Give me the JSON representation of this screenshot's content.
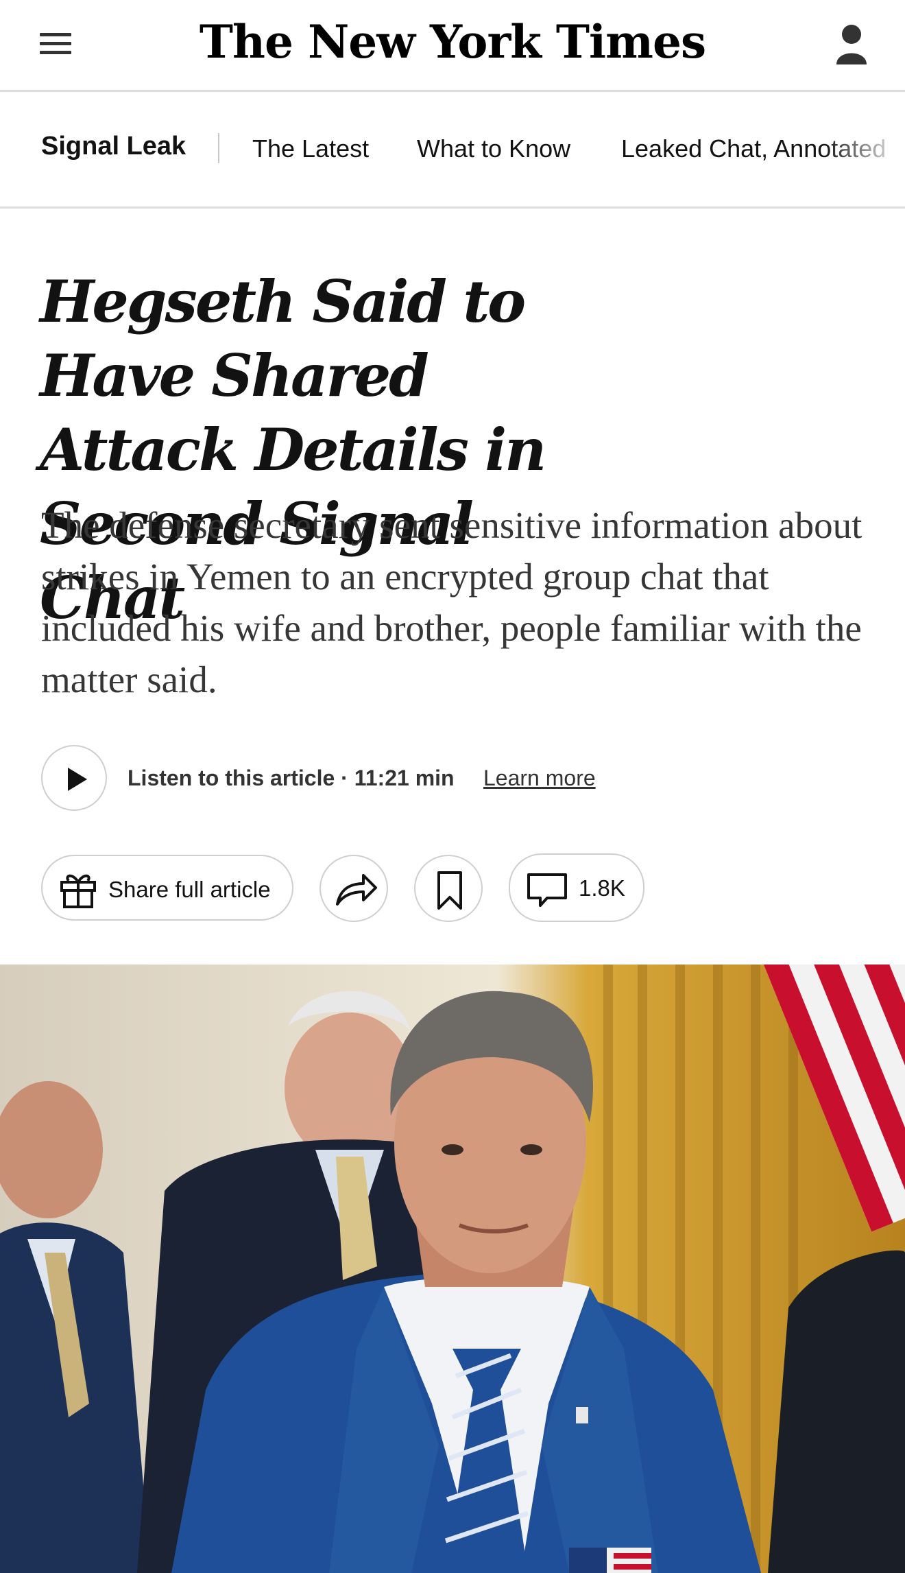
{
  "masthead": {
    "logo_text": "The New York Times",
    "menu_icon": "hamburger-icon",
    "account_icon": "person-icon"
  },
  "section_nav": {
    "title": "Signal Leak",
    "items": [
      {
        "label": "The Latest"
      },
      {
        "label": "What to Know"
      },
      {
        "label": "Leaked Chat, Annotated"
      }
    ]
  },
  "article": {
    "headline": "Hegseth Said to Have Shared Attack Details in Second Signal Chat",
    "summary": "The defense secretary sent sensitive information about strikes in Yemen to an encrypted group chat that included his wife and brother, people familiar with the matter said."
  },
  "audio": {
    "play_icon": "play-icon",
    "listen_label": "Listen to this article · 11:21 min",
    "learn_more": "Learn more"
  },
  "actions": {
    "share_full_label": "Share full article",
    "gift_icon": "gift-icon",
    "share_icon": "share-arrow-icon",
    "bookmark_icon": "bookmark-icon",
    "comment_icon": "comment-icon",
    "comment_count": "1.8K"
  },
  "colors": {
    "text": "#121212",
    "summary_text": "#363636",
    "border": "#cfcfcf",
    "divider": "#dcdcdc",
    "suit_blue": "#1f4f98"
  }
}
